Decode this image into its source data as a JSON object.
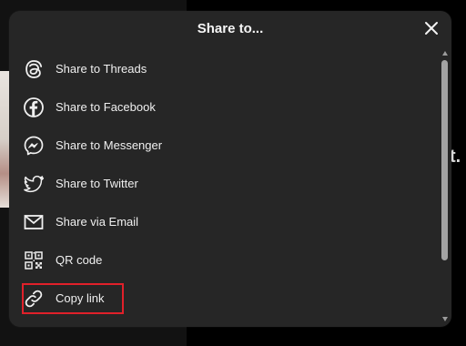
{
  "modal": {
    "title": "Share to...",
    "close_icon": "close-icon"
  },
  "items": [
    {
      "label": "Share to Threads",
      "icon": "threads-icon"
    },
    {
      "label": "Share to Facebook",
      "icon": "facebook-icon"
    },
    {
      "label": "Share to Messenger",
      "icon": "messenger-icon"
    },
    {
      "label": "Share to Twitter",
      "icon": "twitter-icon"
    },
    {
      "label": "Share via Email",
      "icon": "email-icon"
    },
    {
      "label": "QR code",
      "icon": "qr-code-icon"
    },
    {
      "label": "Copy link",
      "icon": "link-icon"
    }
  ],
  "background": {
    "partial_glyph": "t."
  },
  "colors": {
    "modal_bg": "#262626",
    "text": "#f0f0f0",
    "highlight": "#e0202a"
  }
}
